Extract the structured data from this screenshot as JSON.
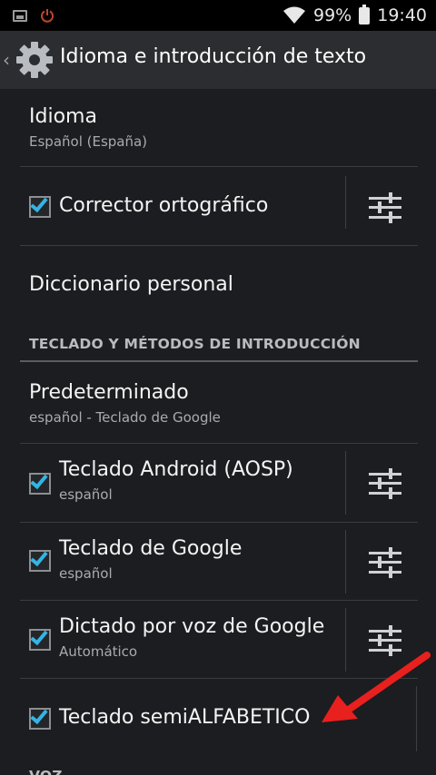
{
  "status_bar": {
    "battery_percent": "99%",
    "time": "19:40",
    "icons": [
      "image-notification-icon",
      "power-icon",
      "wifi-icon",
      "battery-icon"
    ]
  },
  "action_bar": {
    "title": "Idioma e introducción de texto",
    "icons": [
      "back-chevron-icon",
      "settings-gear-icon"
    ]
  },
  "items": {
    "idioma": {
      "title": "Idioma",
      "summary": "Español (España)"
    },
    "corrector": {
      "title": "Corrector ortográfico",
      "checked": true
    },
    "diccionario": {
      "title": "Diccionario personal"
    }
  },
  "section_keyboards": {
    "label": "TECLADO Y MÉTODOS DE INTRODUCCIÓN"
  },
  "keyboards": {
    "predeterminado": {
      "title": "Predeterminado",
      "summary": "español - Teclado de Google"
    },
    "aosp": {
      "title": "Teclado Android (AOSP)",
      "summary": "español",
      "checked": true
    },
    "google": {
      "title": "Teclado de Google",
      "summary": "español",
      "checked": true
    },
    "dictado": {
      "title": "Dictado por voz de Google",
      "summary": "Automático",
      "checked": true
    },
    "semialfabetico": {
      "title": "Teclado semiALFABETICO",
      "checked": true
    }
  },
  "section_voz": {
    "label": "VOZ"
  },
  "colors": {
    "accent": "#33b5e5",
    "annotation_arrow": "#e8201e",
    "background": "#1b1d20",
    "action_bar": "#2b2d30"
  }
}
